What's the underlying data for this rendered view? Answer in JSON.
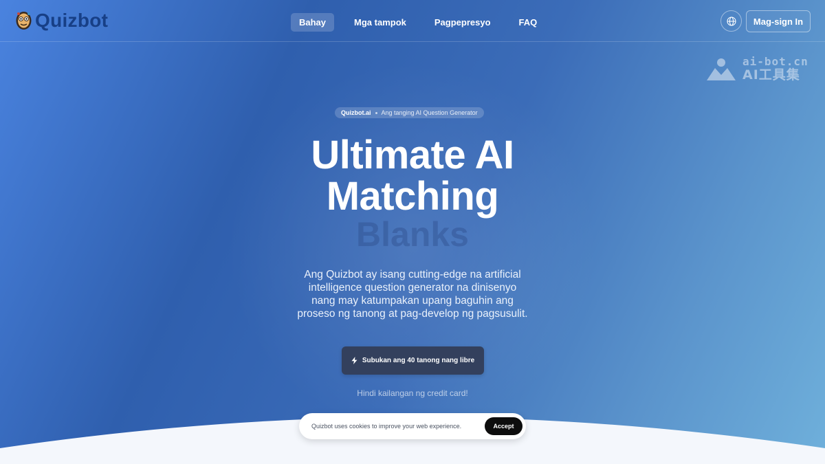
{
  "header": {
    "logo_text": "Quizbot",
    "nav": [
      {
        "label": "Bahay",
        "active": true
      },
      {
        "label": "Mga tampok",
        "active": false
      },
      {
        "label": "Pagpepresyo",
        "active": false
      },
      {
        "label": "FAQ",
        "active": false
      }
    ],
    "language_icon": "globe-icon",
    "signin_label": "Mag-sign In"
  },
  "watermark": {
    "line1": "ai-bot.cn",
    "line2": "AI工具集"
  },
  "hero": {
    "pill_brand": "Quizbot.ai",
    "pill_text": "Ang tanging AI Question Generator",
    "title_line1": "Ultimate AI",
    "title_line2": "Matching",
    "title_ghost": "Blanks",
    "description": "Ang Quizbot ay isang cutting-edge na artificial intelligence question generator na dinisenyo nang may katumpakan upang baguhin ang proseso ng tanong at pag-develop ng pagsusulit.",
    "cta_label": "Subukan ang 40 tanong nang libre",
    "cta_icon": "lightning-icon",
    "note": "Hindi kailangan ng credit card!"
  },
  "cookie": {
    "text": "Quizbot uses cookies to improve your web experience.",
    "accept_label": "Accept"
  },
  "colors": {
    "logo": "#173f86",
    "cta_bg": "#33405d",
    "accept_bg": "#0d0d0d"
  }
}
